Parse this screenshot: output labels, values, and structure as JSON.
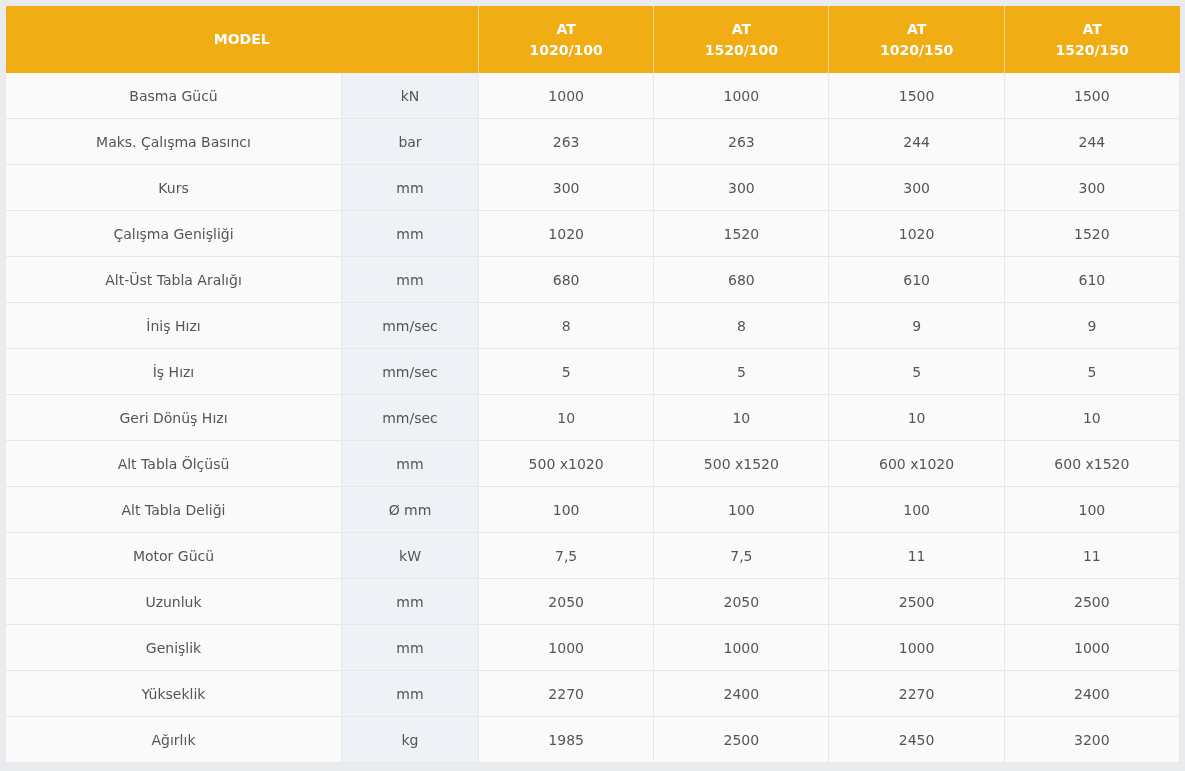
{
  "header": {
    "label": "MODEL",
    "models": [
      {
        "line_1": "AT",
        "line_2": "1020/100"
      },
      {
        "line_1": "AT",
        "line_2": "1520/100"
      },
      {
        "line_1": "AT",
        "line_2": "1020/150"
      },
      {
        "line_1": "AT",
        "line_2": "1520/150"
      }
    ]
  },
  "rows": [
    {
      "label": "Basma Gücü",
      "unit": "kN",
      "values": [
        "1000",
        "1000",
        "1500",
        "1500"
      ]
    },
    {
      "label": "Maks. Çalışma Basıncı",
      "unit": "bar",
      "values": [
        "263",
        "263",
        "244",
        "244"
      ]
    },
    {
      "label": "Kurs",
      "unit": "mm",
      "values": [
        "300",
        "300",
        "300",
        "300"
      ]
    },
    {
      "label": "Çalışma Genişliği",
      "unit": "mm",
      "values": [
        "1020",
        "1520",
        "1020",
        "1520"
      ]
    },
    {
      "label": "Alt-Üst Tabla Aralığı",
      "unit": "mm",
      "values": [
        "680",
        "680",
        "610",
        "610"
      ]
    },
    {
      "label": "İniş Hızı",
      "unit": "mm/sec",
      "values": [
        "8",
        "8",
        "9",
        "9"
      ]
    },
    {
      "label": "İş Hızı",
      "unit": "mm/sec",
      "values": [
        "5",
        "5",
        "5",
        "5"
      ]
    },
    {
      "label": "Geri Dönüş Hızı",
      "unit": "mm/sec",
      "values": [
        "10",
        "10",
        "10",
        "10"
      ]
    },
    {
      "label": "Alt Tabla Ölçüsü",
      "unit": "mm",
      "values": [
        "500 x1020",
        "500 x1520",
        "600 x1020",
        "600 x1520"
      ]
    },
    {
      "label": "Alt Tabla Deliği",
      "unit": "Ø mm",
      "values": [
        "100",
        "100",
        "100",
        "100"
      ]
    },
    {
      "label": "Motor Gücü",
      "unit": "kW",
      "values": [
        "7,5",
        "7,5",
        "11",
        "11"
      ]
    },
    {
      "label": "Uzunluk",
      "unit": "mm",
      "values": [
        "2050",
        "2050",
        "2500",
        "2500"
      ]
    },
    {
      "label": "Genişlik",
      "unit": "mm",
      "values": [
        "1000",
        "1000",
        "1000",
        "1000"
      ]
    },
    {
      "label": "Yükseklik",
      "unit": "mm",
      "values": [
        "2270",
        "2400",
        "2270",
        "2400"
      ]
    },
    {
      "label": "Ağırlık",
      "unit": "kg",
      "values": [
        "1985",
        "2500",
        "2450",
        "3200"
      ]
    }
  ]
}
